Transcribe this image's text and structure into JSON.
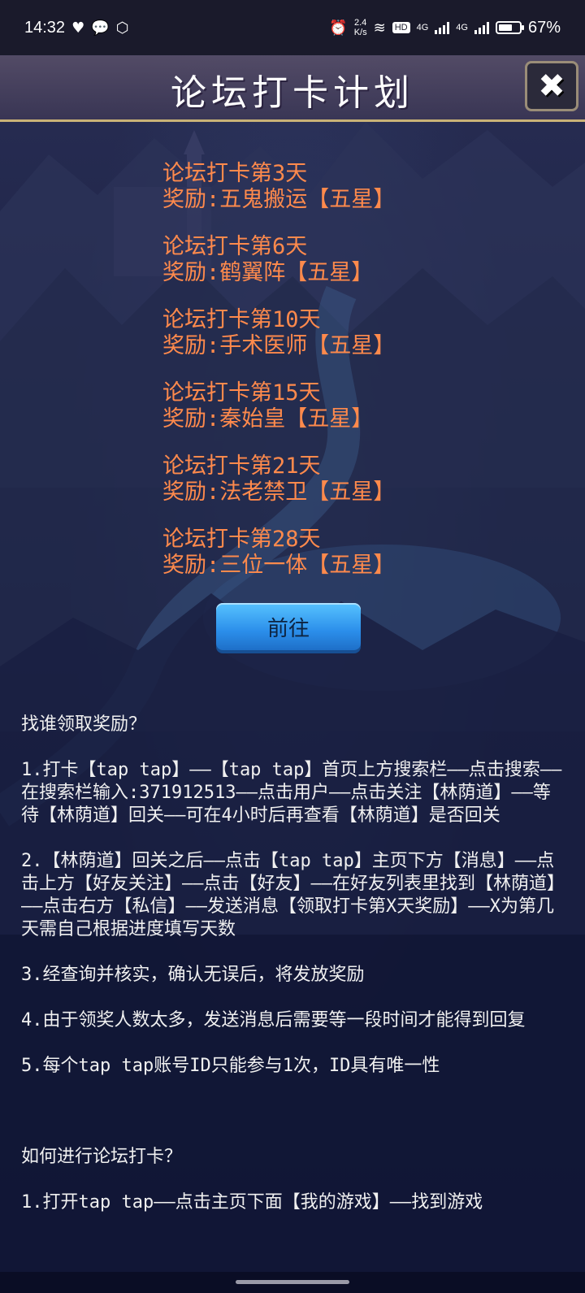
{
  "status_bar": {
    "time": "14:32",
    "notifications": [
      "heart-icon",
      "chat-icon",
      "shield-icon"
    ],
    "net_speed_value": "2.4",
    "net_speed_unit": "K/s",
    "hd_label": "HD",
    "sim1": "4G",
    "sim2": "4G",
    "battery_text": "67%",
    "battery_level": 0.67
  },
  "header": {
    "title": "论坛打卡计划",
    "close_label": "✖"
  },
  "rewards": [
    {
      "day": "论坛打卡第3天",
      "reward": "奖励:五鬼搬运【五星】"
    },
    {
      "day": "论坛打卡第6天",
      "reward": "奖励:鹤翼阵【五星】"
    },
    {
      "day": "论坛打卡第10天",
      "reward": "奖励:手术医师【五星】"
    },
    {
      "day": "论坛打卡第15天",
      "reward": "奖励:秦始皇【五星】"
    },
    {
      "day": "论坛打卡第21天",
      "reward": "奖励:法老禁卫【五星】"
    },
    {
      "day": "论坛打卡第28天",
      "reward": "奖励:三位一体【五星】"
    }
  ],
  "go_button": {
    "label": "前往"
  },
  "instructions": {
    "heading1": "找谁领取奖励？",
    "step1": "1.打卡【tap tap】——【tap tap】首页上方搜索栏——点击搜索——在搜索栏输入:371912513——点击用户——点击关注【林荫道】——等待【林荫道】回关——可在4小时后再查看【林荫道】是否回关",
    "step2": "2.【林荫道】回关之后——点击【tap tap】主页下方【消息】——点击上方【好友关注】——点击【好友】——在好友列表里找到【林荫道】——点击右方【私信】——发送消息【领取打卡第X天奖励】——X为第几天需自己根据进度填写天数",
    "step3": "3.经查询并核实，确认无误后，将发放奖励",
    "step4": "4.由于领奖人数太多，发送消息后需要等一段时间才能得到回复",
    "step5": "5.每个tap tap账号ID只能参与1次，ID具有唯一性",
    "heading2": "如何进行论坛打卡？",
    "step6_partial": "1.打开tap tap——点击主页下面【我的游戏】——找到游戏"
  },
  "colors": {
    "reward_text": "#ff8a4c",
    "header_border": "#c9b277",
    "button_blue": "#2b8eea"
  }
}
